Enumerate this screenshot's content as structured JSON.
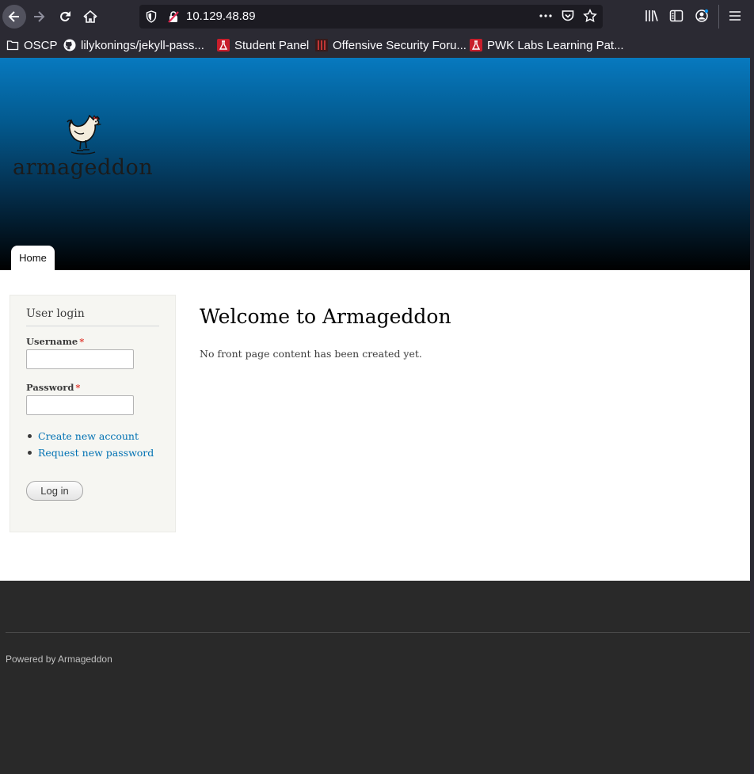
{
  "browser": {
    "url": "10.129.48.89",
    "bookmarks": [
      {
        "label": "OSCP",
        "icon": "folder-icon"
      },
      {
        "label": "lilykonings/jekyll-pass...",
        "icon": "github-icon"
      },
      {
        "label": "Student Panel",
        "icon": "offsec-icon"
      },
      {
        "label": "Offensive Security Foru...",
        "icon": "offsec-forum-icon"
      },
      {
        "label": "PWK Labs Learning Pat...",
        "icon": "offsec-icon"
      }
    ]
  },
  "site": {
    "name": "armageddon",
    "nav": {
      "home": "Home"
    }
  },
  "login": {
    "title": "User login",
    "username_label": "Username",
    "password_label": "Password",
    "required_marker": "*",
    "username_value": "",
    "password_value": "",
    "create_account": "Create new account",
    "request_password": "Request new password",
    "submit": "Log in"
  },
  "main": {
    "title": "Welcome to Armageddon",
    "body": "No front page content has been created yet."
  },
  "footer": {
    "powered_by": "Powered by Armageddon"
  },
  "colors": {
    "header_top": "#0779bf",
    "header_bottom": "#000000",
    "link": "#0071b3",
    "required": "#e0382f",
    "footer_bg": "#292929"
  }
}
